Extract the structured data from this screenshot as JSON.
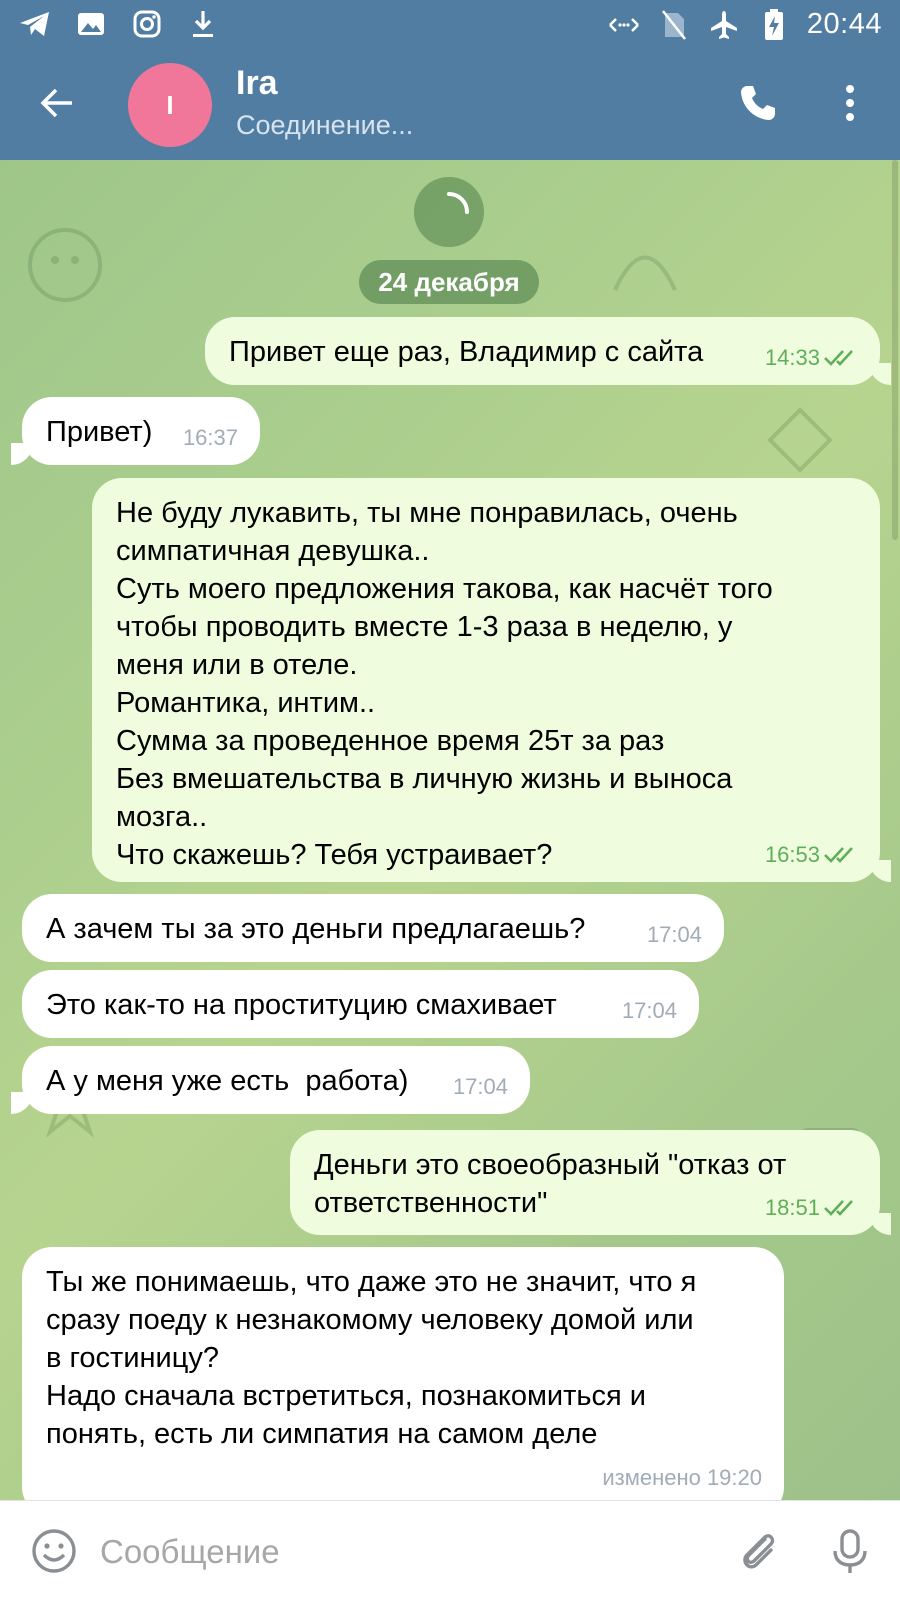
{
  "status_bar": {
    "time": "20:44",
    "left_icons": [
      "telegram-icon",
      "image-icon",
      "instagram-icon",
      "download-icon"
    ],
    "right_icons": [
      "signal-arrows-icon",
      "no-sim-icon",
      "airplane-icon",
      "battery-charging-icon"
    ]
  },
  "header": {
    "avatar_letter": "I",
    "avatar_color": "#f0779a",
    "title": "Ira",
    "status": "Соединение..."
  },
  "colors": {
    "header_bg": "#517da2",
    "incoming_bubble": "#ffffff",
    "outgoing_bubble": "#effdde",
    "outgoing_time": "#5fae5a",
    "incoming_time": "#a0acb6"
  },
  "chat": {
    "date_separator": "24 декабря",
    "messages": [
      {
        "direction": "out",
        "text": "Привет еще раз, Владимир с сайта",
        "time": "14:33",
        "read": true
      },
      {
        "direction": "in",
        "text": "Привет)",
        "time": "16:37"
      },
      {
        "direction": "out",
        "text": "Не буду лукавить, ты мне понравилась, очень\nсимпатичная девушка..\nСуть моего предложения такова, как насчёт того\nчтобы проводить вместе 1-3 раза в неделю, у\nменя или в отеле.\nРомантика, интим..\nСумма за проведенное время 25т за раз\nБез вмешательства в личную жизнь и выноса\nмозга..\nЧто скажешь? Тебя устраивает?",
        "time": "16:53",
        "read": true
      },
      {
        "direction": "in",
        "text": "А зачем ты за это деньги предлагаешь?",
        "time": "17:04"
      },
      {
        "direction": "in",
        "text": "Это как-то на проституцию смахивает",
        "time": "17:04"
      },
      {
        "direction": "in",
        "text": "А у меня уже есть  работа)",
        "time": "17:04"
      },
      {
        "direction": "out",
        "text": "Деньги это своеобразный \"отказ от\nответственности\"",
        "time": "18:51",
        "read": true
      },
      {
        "direction": "in",
        "text": "Ты же понимаешь, что даже это не значит, что я\nсразу поеду к незнакомому человеку домой или\nв гостиницу?\nНадо сначала встретиться, познакомиться и\nпонять, есть ли симпатия на самом деле",
        "time": "изменено 19:20"
      }
    ]
  },
  "input_bar": {
    "placeholder": "Сообщение"
  }
}
